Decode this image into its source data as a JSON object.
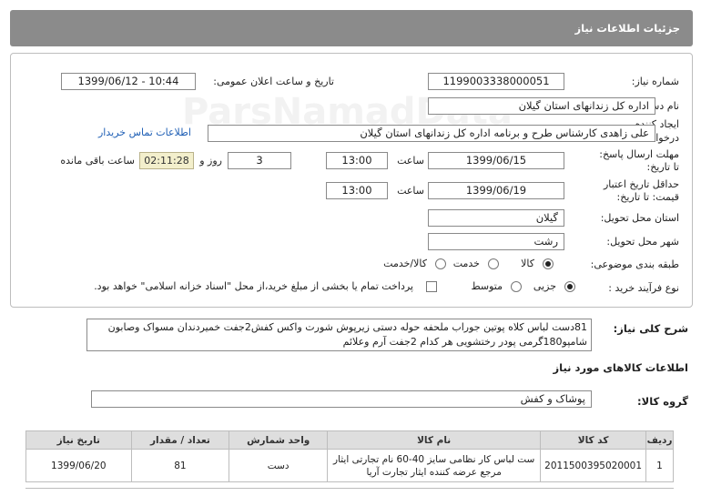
{
  "header": {
    "title": "جزئیات اطلاعات نیاز"
  },
  "fields": {
    "need_number_label": "شماره نیاز:",
    "need_number": "1199003338000051",
    "announce_label": "تاریخ و ساعت اعلان عمومی:",
    "announce_value": "1399/06/12 - 10:44",
    "buyer_org_label": "نام دستگاه خریدار:",
    "buyer_org": "اداره کل زندانهای استان گیلان",
    "creator_label_1": "ایجاد کننده",
    "creator_label_2": "درخواست:",
    "creator": "علی زاهدی کارشناس طرح و برنامه اداره کل زندانهای استان گیلان",
    "contact_link": "اطلاعات تماس خریدار",
    "deadline_label_1": "مهلت ارسال پاسخ:",
    "deadline_label_2": "تا تاریخ:",
    "deadline_date": "1399/06/15",
    "time_label": "ساعت",
    "deadline_time": "13:00",
    "days_value": "3",
    "days_label": "روز و",
    "timer": "02:11:28",
    "remaining_label": "ساعت باقی مانده",
    "validity_label_1": "حداقل تاریخ اعتبار",
    "validity_label_2": "قیمت: تا تاریخ:",
    "validity_date": "1399/06/19",
    "validity_time": "13:00",
    "province_label": "استان محل تحویل:",
    "province": "گیلان",
    "city_label": "شهر محل تحویل:",
    "city": "رشت",
    "category_label": "طبقه بندی موضوعی:",
    "category_options": [
      "کالا",
      "خدمت",
      "کالا/خدمت"
    ],
    "process_label": "نوع فرآیند خرید :",
    "process_options": [
      "جزیی",
      "متوسط"
    ],
    "payment_note": "پرداخت تمام یا بخشی از مبلغ خرید،از محل \"اسناد خزانه اسلامی\" خواهد بود."
  },
  "description": {
    "label": "شرح کلی نیاز:",
    "text": "81دست لباس کلاه پوتین جوراب ملحفه حوله دستی زیرپوش شورت واکس کفش2جفت خمیردندان مسواک وصابون شامپو180گرمی پودر رختشویی هر کدام 2جفت آرم وعلائم"
  },
  "goods_info": {
    "title": "اطلاعات کالاهای مورد نیاز",
    "group_label": "گروه کالا:",
    "group_value": "پوشاک و کفش"
  },
  "table": {
    "headers": [
      "ردیف",
      "کد کالا",
      "نام کالا",
      "واحد شمارش",
      "تعداد / مقدار",
      "تاریخ نیاز"
    ],
    "rows": [
      [
        "1",
        "2011500395020001",
        "ست لباس کار نظامی سایز 40-60 نام تجارتی ایثار مرجع عرضه کننده ایثار تجارت آریا",
        "دست",
        "81",
        "1399/06/20"
      ]
    ]
  },
  "watermark": "ParsNamadData"
}
